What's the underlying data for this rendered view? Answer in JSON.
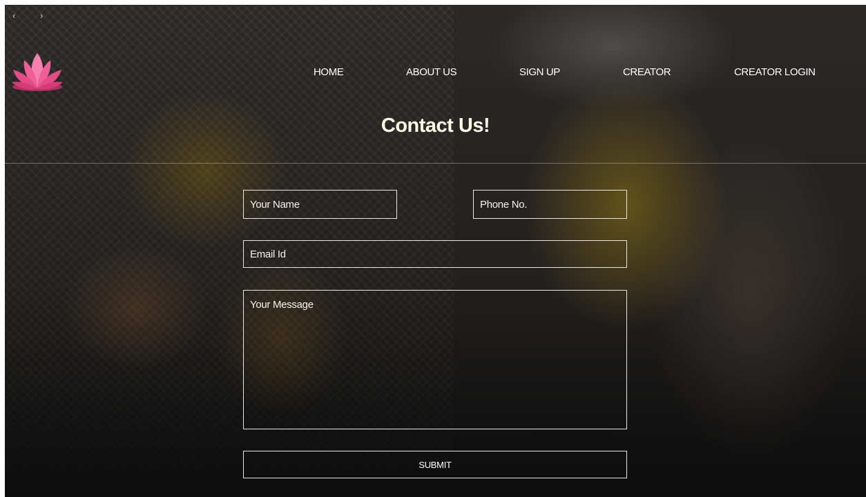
{
  "slider": {
    "prev_glyph": "‹",
    "next_glyph": "›"
  },
  "nav": {
    "items": [
      {
        "label": "HOME"
      },
      {
        "label": "ABOUT US"
      },
      {
        "label": "SIGN UP"
      },
      {
        "label": "CREATOR"
      },
      {
        "label": "CREATOR LOGIN"
      }
    ]
  },
  "page": {
    "title": "Contact Us!"
  },
  "form": {
    "name_placeholder": "Your Name",
    "phone_placeholder": "Phone No.",
    "email_placeholder": "Email Id",
    "message_placeholder": "Your Message",
    "submit_label": "SUBMIT"
  },
  "icons": {
    "logo": "lotus-logo-icon"
  },
  "colors": {
    "title": "#fffbe6",
    "logo_petal": "#f06aa0",
    "border": "#e8e8e8"
  }
}
